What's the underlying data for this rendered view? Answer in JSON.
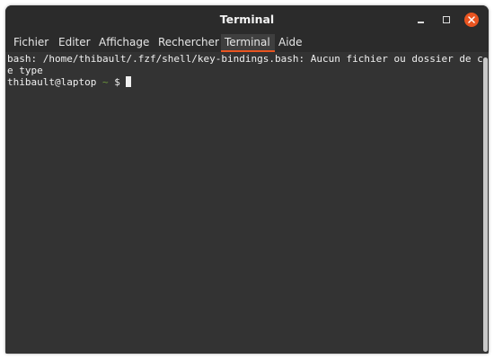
{
  "window": {
    "title": "Terminal"
  },
  "menu": {
    "items": [
      "Fichier",
      "Editer",
      "Affichage",
      "Rechercher",
      "Terminal",
      "Aide"
    ],
    "active": "Terminal"
  },
  "terminal": {
    "line1": "bash: /home/thibault/.fzf/shell/key-bindings.bash: Aucun fichier ou dossier de c",
    "line2": "e type",
    "prompt_user": "thibault@laptop",
    "prompt_dir": "~",
    "prompt_symbol": "$"
  },
  "colors": {
    "accent": "#e95420",
    "background": "#333333",
    "titlebar": "#2b2b2b",
    "prompt_dir": "#6e9a3c"
  },
  "icons": {
    "minimize": "minimize-icon",
    "maximize": "maximize-icon",
    "close": "close-icon"
  }
}
